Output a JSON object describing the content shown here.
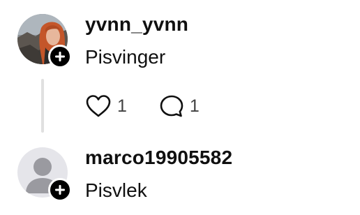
{
  "posts": [
    {
      "username": "yvnn_yvnn",
      "text": "Pisvinger",
      "avatar_icon": "profile-photo",
      "follow_icon": "plus-icon",
      "likes": "1",
      "replies": "1",
      "like_icon": "heart-icon",
      "reply_icon": "comment-icon"
    },
    {
      "username": "marco19905582",
      "text": "Pisvlek",
      "avatar_icon": "default-person-icon",
      "follow_icon": "plus-icon"
    }
  ],
  "colors": {
    "text": "#101010",
    "secondary_text": "#424242",
    "thread_line": "#e0e0e0",
    "badge": "#000000",
    "default_avatar_bg": "#e5e5ea",
    "default_avatar_fg": "#9a9aa0"
  }
}
